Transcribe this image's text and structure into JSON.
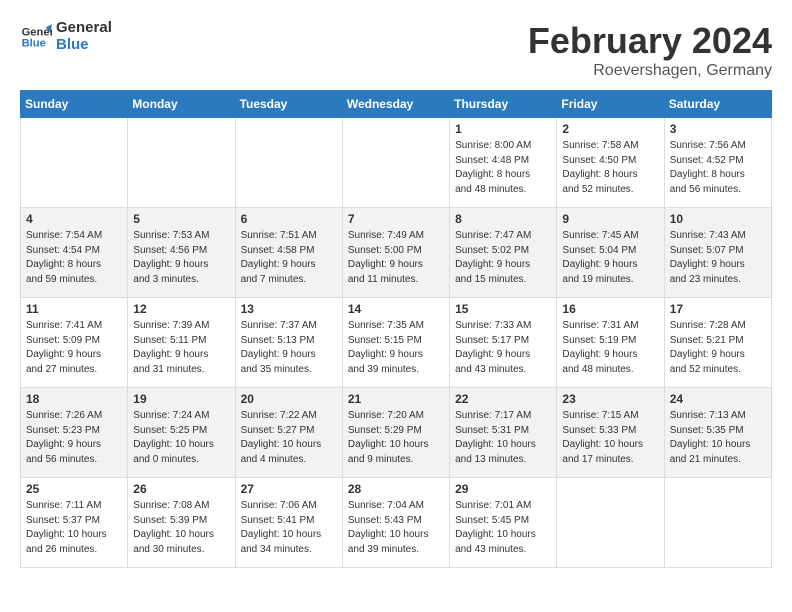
{
  "logo": {
    "line1": "General",
    "line2": "Blue"
  },
  "title": "February 2024",
  "subtitle": "Roevershagen, Germany",
  "headers": [
    "Sunday",
    "Monday",
    "Tuesday",
    "Wednesday",
    "Thursday",
    "Friday",
    "Saturday"
  ],
  "weeks": [
    [
      {
        "day": "",
        "info": ""
      },
      {
        "day": "",
        "info": ""
      },
      {
        "day": "",
        "info": ""
      },
      {
        "day": "",
        "info": ""
      },
      {
        "day": "1",
        "info": "Sunrise: 8:00 AM\nSunset: 4:48 PM\nDaylight: 8 hours\nand 48 minutes."
      },
      {
        "day": "2",
        "info": "Sunrise: 7:58 AM\nSunset: 4:50 PM\nDaylight: 8 hours\nand 52 minutes."
      },
      {
        "day": "3",
        "info": "Sunrise: 7:56 AM\nSunset: 4:52 PM\nDaylight: 8 hours\nand 56 minutes."
      }
    ],
    [
      {
        "day": "4",
        "info": "Sunrise: 7:54 AM\nSunset: 4:54 PM\nDaylight: 8 hours\nand 59 minutes."
      },
      {
        "day": "5",
        "info": "Sunrise: 7:53 AM\nSunset: 4:56 PM\nDaylight: 9 hours\nand 3 minutes."
      },
      {
        "day": "6",
        "info": "Sunrise: 7:51 AM\nSunset: 4:58 PM\nDaylight: 9 hours\nand 7 minutes."
      },
      {
        "day": "7",
        "info": "Sunrise: 7:49 AM\nSunset: 5:00 PM\nDaylight: 9 hours\nand 11 minutes."
      },
      {
        "day": "8",
        "info": "Sunrise: 7:47 AM\nSunset: 5:02 PM\nDaylight: 9 hours\nand 15 minutes."
      },
      {
        "day": "9",
        "info": "Sunrise: 7:45 AM\nSunset: 5:04 PM\nDaylight: 9 hours\nand 19 minutes."
      },
      {
        "day": "10",
        "info": "Sunrise: 7:43 AM\nSunset: 5:07 PM\nDaylight: 9 hours\nand 23 minutes."
      }
    ],
    [
      {
        "day": "11",
        "info": "Sunrise: 7:41 AM\nSunset: 5:09 PM\nDaylight: 9 hours\nand 27 minutes."
      },
      {
        "day": "12",
        "info": "Sunrise: 7:39 AM\nSunset: 5:11 PM\nDaylight: 9 hours\nand 31 minutes."
      },
      {
        "day": "13",
        "info": "Sunrise: 7:37 AM\nSunset: 5:13 PM\nDaylight: 9 hours\nand 35 minutes."
      },
      {
        "day": "14",
        "info": "Sunrise: 7:35 AM\nSunset: 5:15 PM\nDaylight: 9 hours\nand 39 minutes."
      },
      {
        "day": "15",
        "info": "Sunrise: 7:33 AM\nSunset: 5:17 PM\nDaylight: 9 hours\nand 43 minutes."
      },
      {
        "day": "16",
        "info": "Sunrise: 7:31 AM\nSunset: 5:19 PM\nDaylight: 9 hours\nand 48 minutes."
      },
      {
        "day": "17",
        "info": "Sunrise: 7:28 AM\nSunset: 5:21 PM\nDaylight: 9 hours\nand 52 minutes."
      }
    ],
    [
      {
        "day": "18",
        "info": "Sunrise: 7:26 AM\nSunset: 5:23 PM\nDaylight: 9 hours\nand 56 minutes."
      },
      {
        "day": "19",
        "info": "Sunrise: 7:24 AM\nSunset: 5:25 PM\nDaylight: 10 hours\nand 0 minutes."
      },
      {
        "day": "20",
        "info": "Sunrise: 7:22 AM\nSunset: 5:27 PM\nDaylight: 10 hours\nand 4 minutes."
      },
      {
        "day": "21",
        "info": "Sunrise: 7:20 AM\nSunset: 5:29 PM\nDaylight: 10 hours\nand 9 minutes."
      },
      {
        "day": "22",
        "info": "Sunrise: 7:17 AM\nSunset: 5:31 PM\nDaylight: 10 hours\nand 13 minutes."
      },
      {
        "day": "23",
        "info": "Sunrise: 7:15 AM\nSunset: 5:33 PM\nDaylight: 10 hours\nand 17 minutes."
      },
      {
        "day": "24",
        "info": "Sunrise: 7:13 AM\nSunset: 5:35 PM\nDaylight: 10 hours\nand 21 minutes."
      }
    ],
    [
      {
        "day": "25",
        "info": "Sunrise: 7:11 AM\nSunset: 5:37 PM\nDaylight: 10 hours\nand 26 minutes."
      },
      {
        "day": "26",
        "info": "Sunrise: 7:08 AM\nSunset: 5:39 PM\nDaylight: 10 hours\nand 30 minutes."
      },
      {
        "day": "27",
        "info": "Sunrise: 7:06 AM\nSunset: 5:41 PM\nDaylight: 10 hours\nand 34 minutes."
      },
      {
        "day": "28",
        "info": "Sunrise: 7:04 AM\nSunset: 5:43 PM\nDaylight: 10 hours\nand 39 minutes."
      },
      {
        "day": "29",
        "info": "Sunrise: 7:01 AM\nSunset: 5:45 PM\nDaylight: 10 hours\nand 43 minutes."
      },
      {
        "day": "",
        "info": ""
      },
      {
        "day": "",
        "info": ""
      }
    ]
  ]
}
